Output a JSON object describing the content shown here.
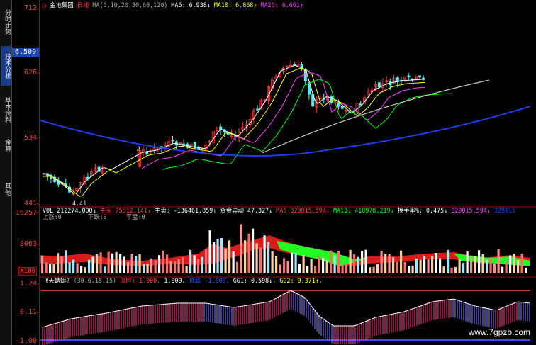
{
  "sidebar": {
    "tabs": [
      {
        "label": "分时走势",
        "active": false
      },
      {
        "label": "技术分析",
        "active": true
      },
      {
        "label": "基本资料",
        "active": false
      },
      {
        "label": "金算",
        "active": false
      },
      {
        "label": "其他",
        "active": false
      }
    ]
  },
  "price_axis": {
    "top": "712",
    "current": "6.509",
    "p1": "626",
    "p2": "534",
    "p3": "441",
    "marker_low": "4.41",
    "marker_a": "A"
  },
  "main_header": {
    "stock": "金地集团",
    "period": "日线",
    "params": "MA(5,10,20,30,60,120)",
    "ma5": "MA5: 6.938↓",
    "ma10": "MA10: 6.868↑",
    "ma20": "MA20: 6.661↑"
  },
  "vol_axis": {
    "top": "16257",
    "mid": "8063",
    "unit": "X100"
  },
  "vol_header": {
    "vol": "VOL 212274.000↓",
    "vol_tag": "主买",
    "buy": "75812.141↓",
    "main_label": "主卖:",
    "main_val": "-136461.859↑",
    "fund": "资金异动",
    "fund_val": "47.327↓",
    "ma5": "MA5",
    "ma5_val": "329015.594↓",
    "ma13": "MA13:",
    "ma13_val": "418978.219↓",
    "turnover": "换手率%:",
    "turnover_val": "0.475↓",
    "extra": "329015.594↓",
    "extra2": "329015"
  },
  "vol_row2": {
    "up": "上涨:0",
    "down": "下跌:0",
    "flat": "平盘:0"
  },
  "ind_axis": {
    "top": "1.24",
    "mid": "0.11",
    "bottom": "-1.00"
  },
  "ind_header": {
    "name": "飞天蜻蜓?",
    "params": "(30,6,18,15)",
    "risk_label": "风险:",
    "risk_val": "1.000,",
    "v2": "1.000,",
    "bottom_label": "顶底",
    "bottom_val": "-1.000,",
    "gg1": "GG1: 0.598↓,",
    "gg2": "GG2: 0.371↑,"
  },
  "colors": {
    "up": "#ff3c3c",
    "down": "#54f0f0",
    "ma5": "#ffffff",
    "ma10": "#ffff00",
    "ma20": "#ff40ff",
    "ma30": "#00ff00",
    "ma60": "#c8c8c8",
    "ma120": "#2040ff",
    "axis": "#e04848"
  },
  "watermark": "www.7gpzb.com"
}
